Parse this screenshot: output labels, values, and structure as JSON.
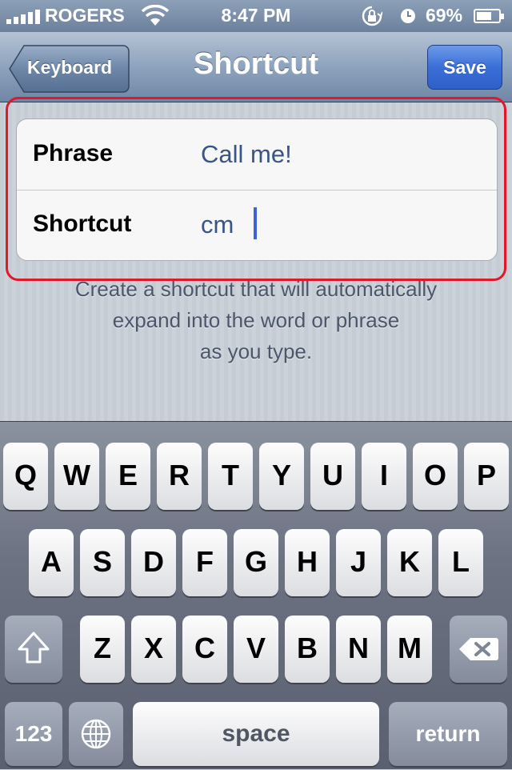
{
  "status_bar": {
    "carrier": "ROGERS",
    "time": "8:47 PM",
    "battery_percent": "69%",
    "battery_level": 0.69
  },
  "nav": {
    "back_label": "Keyboard",
    "title": "Shortcut",
    "save_label": "Save"
  },
  "form": {
    "rows": [
      {
        "label": "Phrase",
        "value": "Call me!"
      },
      {
        "label": "Shortcut",
        "value": "cm"
      }
    ]
  },
  "footer": {
    "lines": [
      "Create a shortcut that will automatically",
      "expand into the word or phrase",
      "as you type."
    ]
  },
  "keyboard": {
    "row1": [
      "Q",
      "W",
      "E",
      "R",
      "T",
      "Y",
      "U",
      "I",
      "O",
      "P"
    ],
    "row2": [
      "A",
      "S",
      "D",
      "F",
      "G",
      "H",
      "J",
      "K",
      "L"
    ],
    "row3": [
      "Z",
      "X",
      "C",
      "V",
      "B",
      "N",
      "M"
    ],
    "numbers_label": "123",
    "space_label": "space",
    "return_label": "return"
  },
  "colors": {
    "highlight": "#e0182a",
    "save_button": "#3b6fd6",
    "input_text": "#3a5585",
    "caret": "#3d63d8"
  }
}
